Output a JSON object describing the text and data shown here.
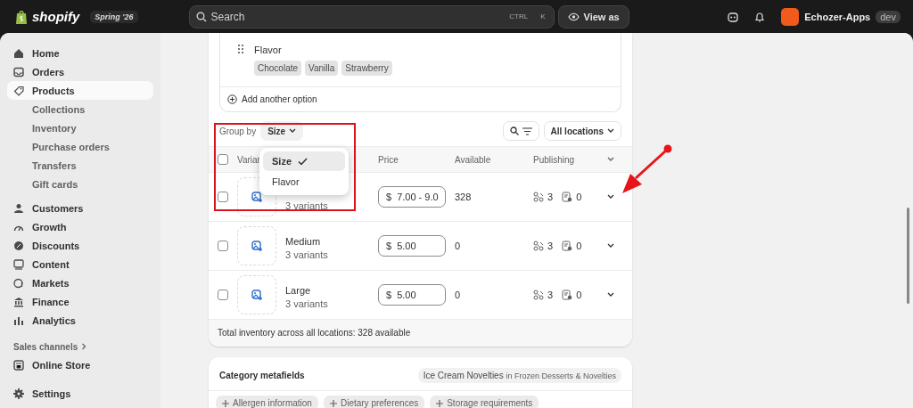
{
  "topbar": {
    "logo": "shopify",
    "edition": "Spring '26",
    "search": {
      "placeholder": "Search"
    },
    "shortcut": [
      "CTRL",
      "K"
    ],
    "view_as": "View as",
    "store": "Echozer-Apps",
    "store_badge": "dev"
  },
  "sidebar": {
    "items": [
      {
        "label": "Home",
        "selected": false
      },
      {
        "label": "Orders",
        "selected": false
      },
      {
        "label": "Products",
        "selected": true,
        "children": [
          {
            "label": "Collections"
          },
          {
            "label": "Inventory"
          },
          {
            "label": "Purchase orders"
          },
          {
            "label": "Transfers"
          },
          {
            "label": "Gift cards"
          }
        ]
      },
      {
        "label": "Customers",
        "selected": false
      },
      {
        "label": "Growth",
        "selected": false
      },
      {
        "label": "Discounts",
        "selected": false
      },
      {
        "label": "Content",
        "selected": false
      },
      {
        "label": "Markets",
        "selected": false
      },
      {
        "label": "Finance",
        "selected": false
      },
      {
        "label": "Analytics",
        "selected": false
      }
    ],
    "sales_channels": {
      "label": "Sales channels",
      "items": [
        {
          "label": "Online Store",
          "selected": false
        }
      ]
    },
    "settings": {
      "label": "Settings",
      "selected": false
    }
  },
  "variants": {
    "option": {
      "name": "Flavor",
      "values": [
        "Chocolate",
        "Vanilla",
        "Strawberry"
      ]
    },
    "add_option": "Add another option",
    "group_by": {
      "label": "Group by",
      "value": "Size",
      "menu": [
        {
          "label": "Size",
          "selected": true
        },
        {
          "label": "Flavor",
          "selected": false
        }
      ]
    },
    "location_filter": "All locations",
    "select_all": {
      "checked": false
    },
    "columns": [
      "Variar",
      "Price",
      "Available",
      "Publishing"
    ],
    "rows": [
      {
        "subtitle": "3 variants",
        "currency": "$",
        "price": "7.00 - 9.0",
        "available": "328",
        "channels": "3",
        "catalogs": "0",
        "checked": false
      },
      {
        "name": "Medium",
        "subtitle": "3 variants",
        "currency": "$",
        "price": "5.00",
        "available": "0",
        "channels": "3",
        "catalogs": "0",
        "checked": false
      },
      {
        "name": "Large",
        "subtitle": "3 variants",
        "currency": "$",
        "price": "5.00",
        "available": "0",
        "channels": "3",
        "catalogs": "0",
        "checked": false
      }
    ],
    "total": "Total inventory across all locations: 328 available"
  },
  "metafields": {
    "title": "Category metafields",
    "category": "Ice Cream Novelties **in Frozen Desserts & Novelties**",
    "buttons": [
      "Allergen information",
      "Dietary preferences",
      "Storage requirements"
    ]
  }
}
